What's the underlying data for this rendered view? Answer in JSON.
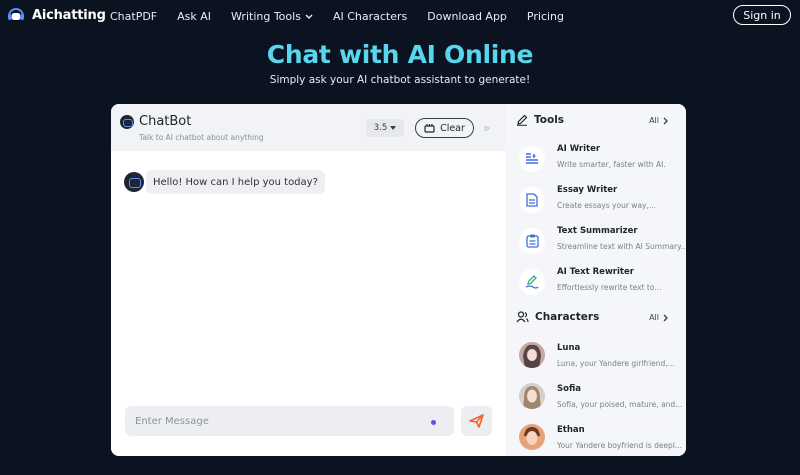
{
  "nav": {
    "brand": "Aichatting",
    "links": [
      "ChatPDF",
      "Ask AI",
      "Writing Tools",
      "AI Characters",
      "Download App",
      "Pricing"
    ],
    "signin": "Sign in"
  },
  "hero": {
    "title": "Chat with AI Online",
    "subtitle": "Simply ask your AI chatbot assistant to generate!"
  },
  "chat": {
    "title": "ChatBot",
    "subtitle": "Talk to AI chatbot about anything",
    "model": "3.5",
    "clear_label": "Clear",
    "message": "Hello! How can I help you today?",
    "input_placeholder": "Enter Message"
  },
  "tools": {
    "heading": "Tools",
    "all_label": "All",
    "items": [
      {
        "name": "AI Writer",
        "desc": "Write smarter, faster with AI."
      },
      {
        "name": "Essay Writer",
        "desc": "Create essays your way,..."
      },
      {
        "name": "Text Summarizer",
        "desc": "Streamline text with AI Summary..."
      },
      {
        "name": "AI Text Rewriter",
        "desc": "Effortlessly rewrite text to..."
      }
    ]
  },
  "characters": {
    "heading": "Characters",
    "all_label": "All",
    "items": [
      {
        "name": "Luna",
        "desc": "Luna, your Yandere girlfriend,..."
      },
      {
        "name": "Sofia",
        "desc": "Sofia, your poised, mature, and..."
      },
      {
        "name": "Ethan",
        "desc": "Your Yandere boyfriend is deepl..."
      }
    ]
  },
  "colors": {
    "background": "#0b1320",
    "hero_title": "#57d6ee",
    "send_accent": "#f0632f",
    "tool_icon": "#3b6fe0"
  }
}
